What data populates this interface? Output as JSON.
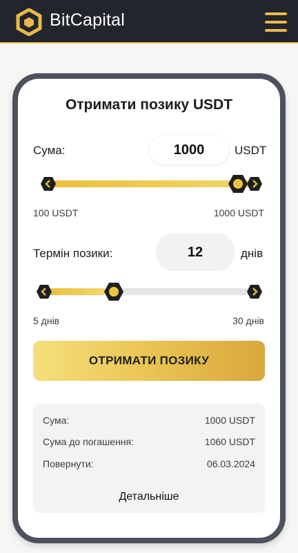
{
  "header": {
    "brand": "BitCapital",
    "logo_icon": "hexagon-logo-icon",
    "menu_icon": "hamburger-menu-icon",
    "accent_color": "#e8b94a",
    "background_color": "#22252b"
  },
  "loan": {
    "title": "Отримати позику USDT",
    "amount": {
      "label": "Сума:",
      "value": "1000",
      "unit": "USDT",
      "min_label": "100 USDT",
      "max_label": "1000 USDT",
      "slider_fraction": 1.0
    },
    "term": {
      "label": "Термін позики:",
      "value": "12",
      "unit": "днів",
      "min_label": "5 днів",
      "max_label": "30 днів",
      "slider_fraction": 0.28
    },
    "submit_label": "ОТРИМАТИ ПОЗИКУ"
  },
  "summary": {
    "rows": [
      {
        "key": "Сума:",
        "value": "1000 USDT"
      },
      {
        "key": "Сума до погашення:",
        "value": "1060 USDT"
      },
      {
        "key": "Повернути:",
        "value": "06.03.2024"
      }
    ],
    "details_link": "Детальніше"
  }
}
